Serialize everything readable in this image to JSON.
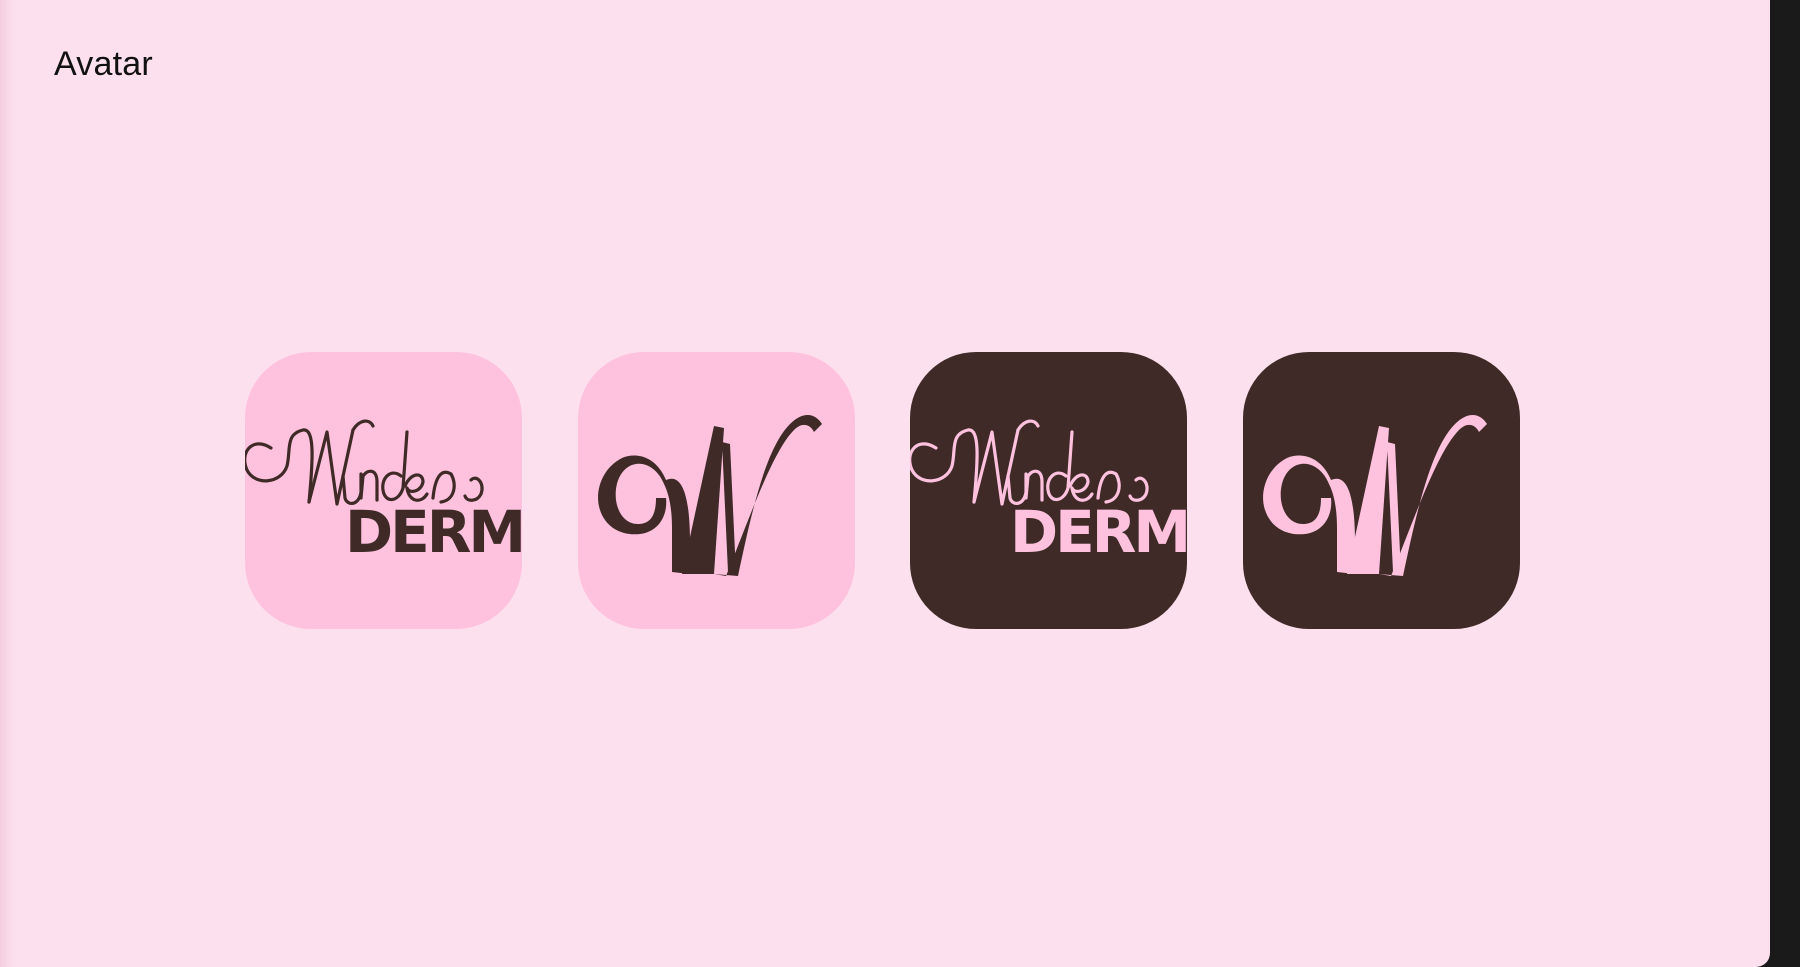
{
  "page": {
    "title": "Avatar"
  },
  "brand": {
    "wordmark_script": "Wunder",
    "wordmark_block": "DERM",
    "monogram": "W"
  },
  "avatars": [
    {
      "name": "wordmark-light",
      "variant": "wordmark",
      "background": "#fec2df",
      "ink": "#3f2a27"
    },
    {
      "name": "monogram-light",
      "variant": "monogram",
      "background": "#fec2df",
      "ink": "#3f2a27"
    },
    {
      "name": "wordmark-dark",
      "variant": "wordmark",
      "background": "#3f2a27",
      "ink": "#fec2df"
    },
    {
      "name": "monogram-dark",
      "variant": "monogram",
      "background": "#3f2a27",
      "ink": "#fec2df"
    }
  ],
  "colors": {
    "page_background": "#fde0ee",
    "frame": "#1a1a1a",
    "title_text": "#111111"
  }
}
